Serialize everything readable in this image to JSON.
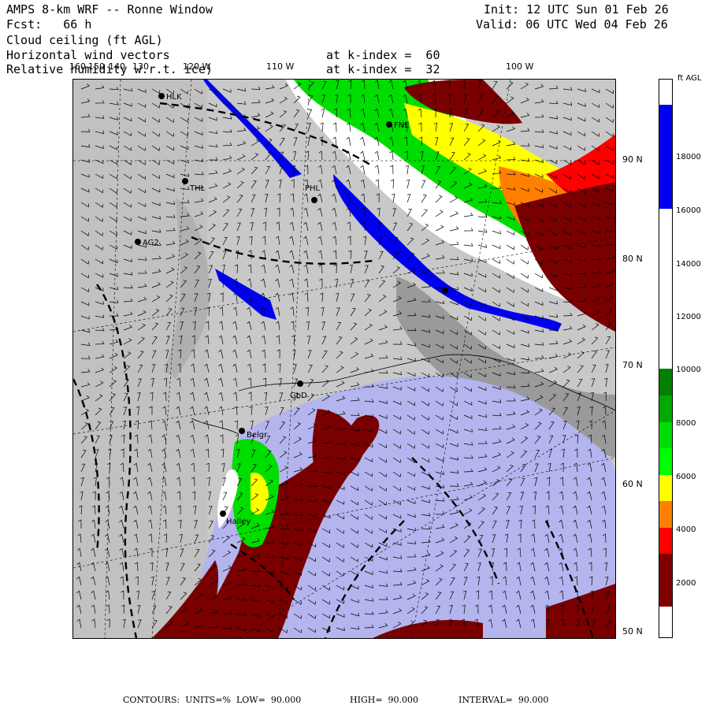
{
  "header": {
    "title": "AMPS 8-km WRF -- Ronne Window",
    "forecast_label": "Fcst:",
    "forecast_hours": "66 h",
    "init": "Init: 12 UTC Sun 01 Feb 26",
    "valid": "Valid: 06 UTC Wed 04 Feb 26",
    "fields": [
      {
        "name": "Cloud ceiling (ft AGL)",
        "level": ""
      },
      {
        "name": "Horizontal wind vectors",
        "level": "at k-index =  60"
      },
      {
        "name": "Relative humidity w.r.t. ice)",
        "level": "at k-index =  32"
      }
    ]
  },
  "map": {
    "longitude_labels": [
      "160",
      "150",
      "140",
      "130",
      "120 W",
      "110 W",
      "100 W"
    ],
    "latitude_labels": [
      "90 N",
      "80 N",
      "70 N",
      "60 N",
      "50 N"
    ],
    "stations": [
      {
        "id": "HLK",
        "label": "HLK"
      },
      {
        "id": "FNE",
        "label": "FNE"
      },
      {
        "id": "THL",
        "label": "THL"
      },
      {
        "id": "PHL",
        "label": "PHL"
      },
      {
        "id": "AG2",
        "label": "AG2"
      },
      {
        "id": "GBD",
        "label": "GbD"
      },
      {
        "id": "BELG",
        "label": "Belgr"
      },
      {
        "id": "HALLEY",
        "label": "Halley"
      }
    ],
    "colors": {
      "land": "#c8c8c8",
      "ocean_ice": "#b4b4ee",
      "ceiling_0_2000": "#7a0000",
      "ceiling_2000_3000": "#ff0000",
      "ceiling_3000_4000": "#ff7f00",
      "ceiling_4000_5000": "#ffff00",
      "ceiling_5000_10000": "#00cc00",
      "ceiling_10000_16000": "#ffffff",
      "ceiling_16000_20000": "#0000ee"
    }
  },
  "colorbar": {
    "unit": "ft AGL",
    "ticks": [
      "18000",
      "16000",
      "14000",
      "12000",
      "10000",
      "8000",
      "6000",
      "4000",
      "2000"
    ],
    "bands": [
      {
        "color": "#ffffff",
        "frac": 0.045
      },
      {
        "color": "#0000ee",
        "frac": 0.187
      },
      {
        "color": "#ffffff",
        "frac": 0.287
      },
      {
        "color": "#008000",
        "frac": 0.048
      },
      {
        "color": "#00aa00",
        "frac": 0.047
      },
      {
        "color": "#00dd00",
        "frac": 0.047
      },
      {
        "color": "#00ff00",
        "frac": 0.048
      },
      {
        "color": "#ffff00",
        "frac": 0.047
      },
      {
        "color": "#ff8000",
        "frac": 0.048
      },
      {
        "color": "#ff0000",
        "frac": 0.047
      },
      {
        "color": "#800000",
        "frac": 0.094
      }
    ]
  },
  "footer": {
    "contours_label": "CONTOURS:  UNITS=%  LOW=  90.000",
    "high": "HIGH=  90.000",
    "interval": "INTERVAL=  90.000"
  }
}
